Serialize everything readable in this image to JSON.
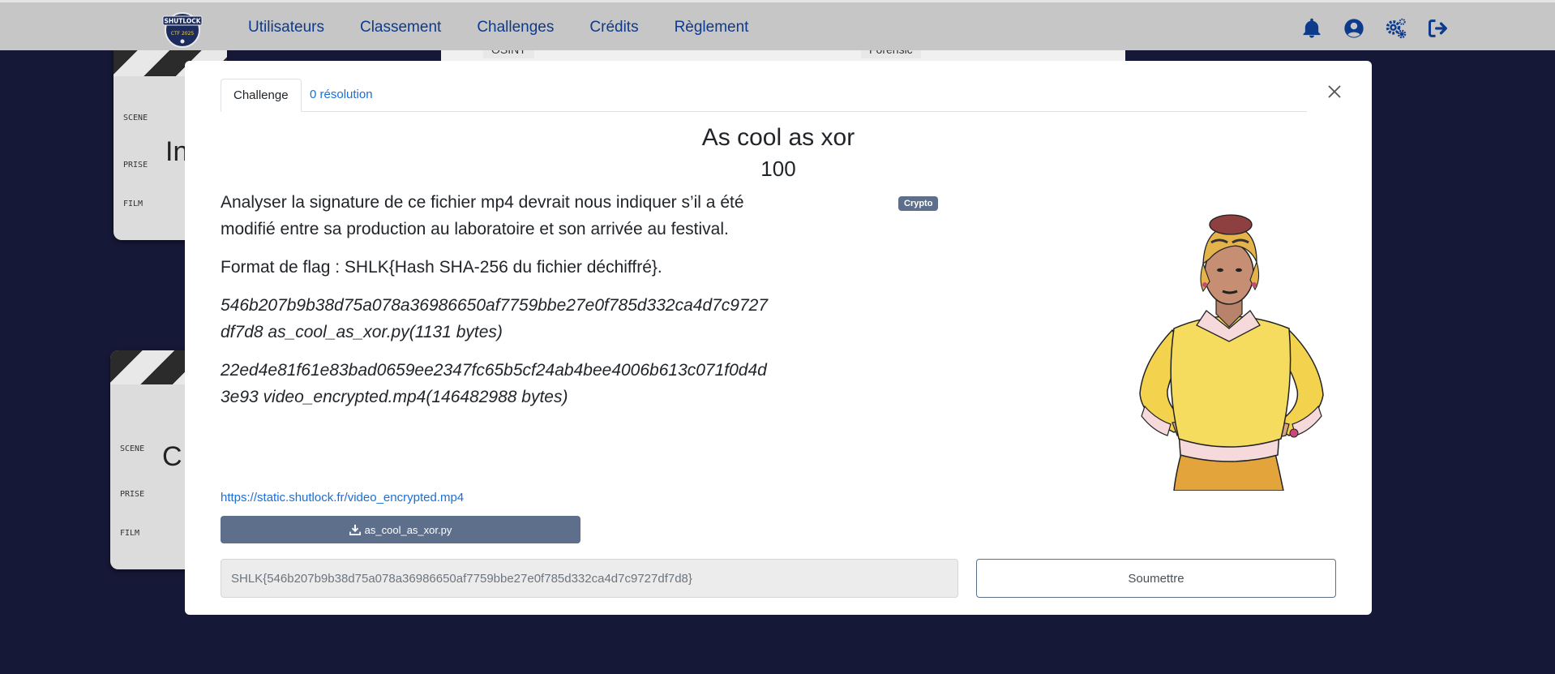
{
  "nav": {
    "logo_text": "SHUTLOCK",
    "logo_subtext": "CTF 2025",
    "links": [
      "Utilisateurs",
      "Classement",
      "Challenges",
      "Crédits",
      "Règlement"
    ],
    "icons": [
      "bell-icon",
      "user-circle-icon",
      "cogs-icon",
      "sign-out-icon"
    ]
  },
  "background": {
    "category_tags": [
      "OSINT",
      "Forensic"
    ],
    "clapper_labels": [
      "SCENE",
      "PRISE",
      "FILM"
    ],
    "clapper_titles": [
      "In",
      "C"
    ]
  },
  "modal": {
    "tabs": [
      {
        "label": "Challenge",
        "active": true
      },
      {
        "label": "0 résolution",
        "active": false
      }
    ],
    "title": "As cool as xor",
    "points": "100",
    "category_badge": "Crypto",
    "description": {
      "intro": "Analyser la signature de ce fichier mp4 devrait nous indiquer s’il a été modifié entre sa production au laboratoire et son arrivée au festival.",
      "flag_format": "Format de flag : SHLK{Hash SHA-256 du fichier déchiffré}.",
      "hash1": "546b207b9b38d75a078a36986650af7759bbe27e0f785d332ca4d7c9727df7d8 as_cool_as_xor.py(1131 bytes)",
      "hash2": "22ed4e81f61e83bad0659ee2347fc65b5cf24ab4bee4006b613c071f0d4d3e93 video_encrypted.mp4(146482988 bytes)"
    },
    "link": "https://static.shutlock.fr/video_encrypted.mp4",
    "download_button": "as_cool_as_xor.py",
    "flag_input": {
      "value": "SHLK{546b207b9b38d75a078a36986650af7759bbe27e0f785d332ca4d7c9727df7d8}",
      "placeholder": ""
    },
    "submit_label": "Soumettre"
  },
  "colors": {
    "navbar": "#c6c6c6",
    "nav_link": "#0e3a8c",
    "page_bg": "#161837",
    "badge_bg": "#5d6f8a",
    "link": "#1b6ed6"
  }
}
